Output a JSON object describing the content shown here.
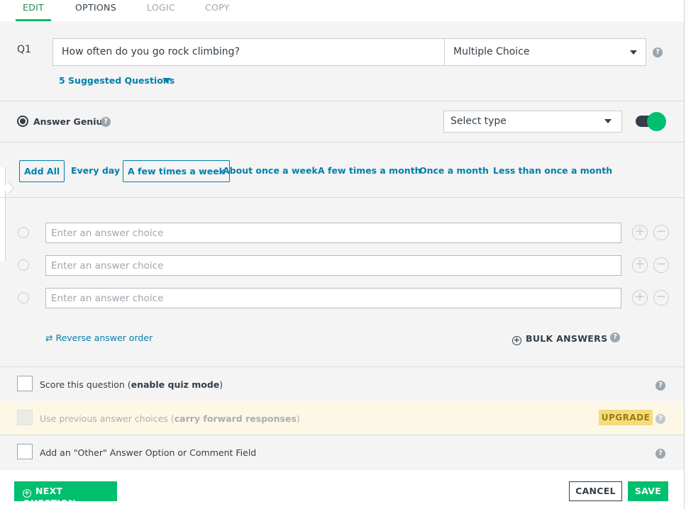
{
  "tabs": [
    {
      "label": "EDIT",
      "state": "active"
    },
    {
      "label": "OPTIONS",
      "state": "normal"
    },
    {
      "label": "LOGIC",
      "state": "disabled"
    },
    {
      "label": "COPY",
      "state": "disabled"
    }
  ],
  "question": {
    "number": "Q1",
    "text": "How often do you go rock climbing?",
    "type": "Multiple Choice",
    "suggested_link": "5 Suggested Questions"
  },
  "answer_genius": {
    "label": "Answer Genius",
    "select_type": "Select type",
    "toggle_on": true
  },
  "suggestions": [
    "Add All",
    "Every day",
    "A few times a week",
    "About once a week",
    "A few times a month",
    "Once a month",
    "Less than once a month"
  ],
  "answers": {
    "placeholder": "Enter an answer choice",
    "rows": [
      "",
      "",
      ""
    ],
    "reverse_label": "Reverse answer order",
    "bulk_label": "BULK ANSWERS"
  },
  "options": {
    "score_text": "Score this question (",
    "score_bold": "enable quiz mode",
    "score_close": ")",
    "carry_text": "Use previous answer choices (",
    "carry_bold": "carry forward responses",
    "carry_close": ")",
    "upgrade_label": "UPGRADE",
    "other_text": "Add an \"Other\" Answer Option or Comment Field"
  },
  "footer": {
    "next_label": "NEXT QUESTION",
    "cancel_label": "CANCEL",
    "save_label": "SAVE"
  },
  "colors": {
    "accent_green": "#00bf6f",
    "link_blue": "#007faa",
    "text_dark": "#333e48",
    "upgrade_yellow": "#f6db7a"
  }
}
